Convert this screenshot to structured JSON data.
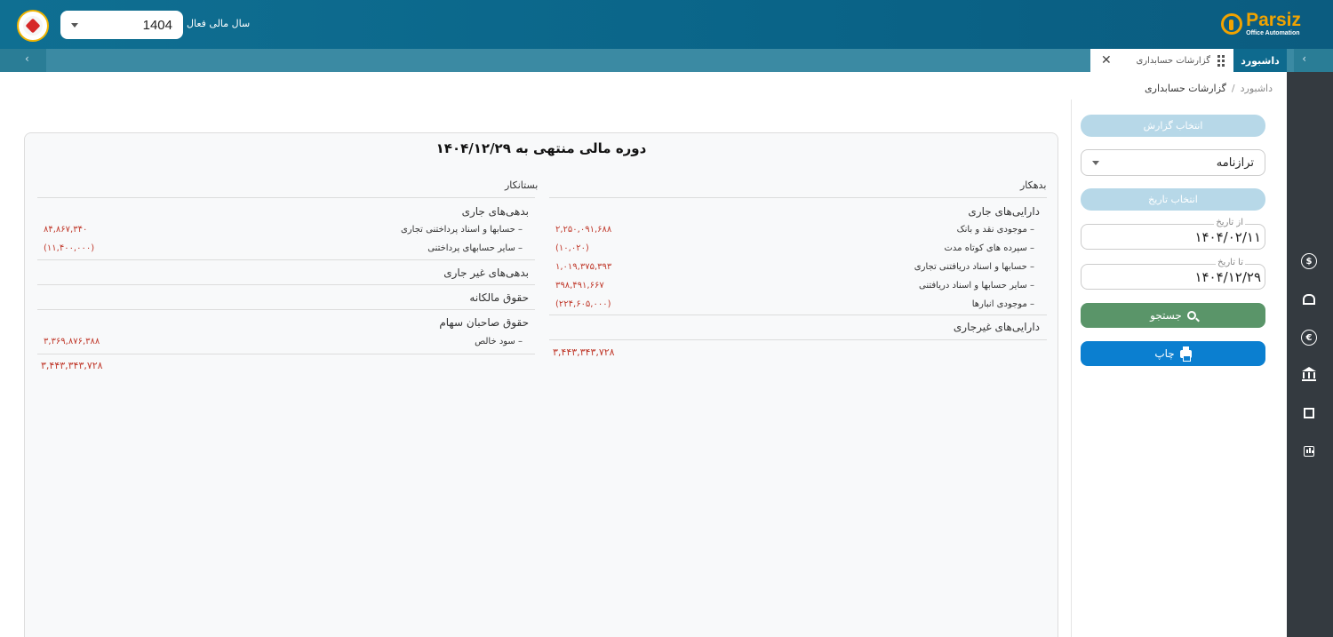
{
  "header": {
    "brand_name": "Parsiz",
    "brand_sub": "Office Automation",
    "fiscal_year_label": "سال مالی فعال",
    "fiscal_year_value": "1404"
  },
  "tabs": {
    "dashboard": "داشبورد",
    "active": "گزارشات حسابداری",
    "close": "✕",
    "scroll_left": "‹",
    "scroll_right": "‹"
  },
  "breadcrumb": {
    "home": "داشبورد",
    "separator": "/",
    "current": "گزارشات حسابداری"
  },
  "filters": {
    "report_select_button": "انتخاب گزارش",
    "report_type": "ترازنامه",
    "date_select_button": "انتخاب تاریخ",
    "from_label": "از تاریخ",
    "from_value": "۱۴۰۴/۰۲/۱۱",
    "to_label": "تا تاریخ",
    "to_value": "۱۴۰۴/۱۲/۲۹",
    "search_button": "جستجو",
    "print_button": "چاپ"
  },
  "rail_icons": [
    "dollar-icon",
    "warehouse-icon",
    "euro-icon",
    "bank-icon",
    "building-icon",
    "chart-icon"
  ],
  "report": {
    "title": "دوره مالی منتهی به ۱۴۰۴/۱۲/۲۹",
    "debit": {
      "header": "بدهکار",
      "current_assets_title": "دارایی‌های جاری",
      "current_assets": [
        {
          "label": "– موجودی نقد و بانک",
          "amount": "۲,۲۵۰,۰۹۱,۶۸۸"
        },
        {
          "label": "– سپرده های کوتاه مدت",
          "amount": "(۱۰,۰۲۰)"
        },
        {
          "label": "– حسابها و اسناد دریافتنی تجاری",
          "amount": "۱,۰۱۹,۳۷۵,۳۹۳"
        },
        {
          "label": "– سایر حسابها و اسناد دریافتنی",
          "amount": "۳۹۸,۴۹۱,۶۶۷"
        },
        {
          "label": "– موجودی انبارها",
          "amount": "(۲۲۴,۶۰۵,۰۰۰)"
        }
      ],
      "noncurrent_assets_title": "دارایی‌های غیرجاری",
      "total": "۳,۴۴۳,۳۴۳,۷۲۸"
    },
    "credit": {
      "header": "بستانکار",
      "current_liabilities_title": "بدهی‌های جاری",
      "current_liabilities": [
        {
          "label": "– حسابها و اسناد پرداختنی تجاری",
          "amount": "۸۴,۸۶۷,۳۴۰"
        },
        {
          "label": "– سایر حسابهای پرداختنی",
          "amount": "(۱۱,۴۰۰,۰۰۰)"
        }
      ],
      "noncurrent_liabilities_title": "بدهی‌های غیر جاری",
      "equity_title": "حقوق مالکانه",
      "shareholders_title": "حقوق صاحبان سهام",
      "shareholders": [
        {
          "label": "– سود خالص",
          "amount": "۳,۳۶۹,۸۷۶,۳۸۸"
        }
      ],
      "total": "۳,۴۴۳,۳۴۳,۷۲۸"
    }
  }
}
